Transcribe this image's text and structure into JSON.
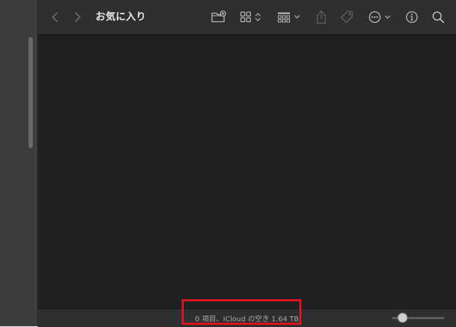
{
  "window": {
    "title": "お気に入り"
  },
  "toolbar": {
    "back": "chevron-left-icon",
    "forward": "chevron-right-icon",
    "new_folder": "folder-plus-icon",
    "view_mode": "grid-view-icon",
    "group": "group-icon",
    "share": "share-icon",
    "tag": "tag-icon",
    "more": "ellipsis-circle-icon",
    "info": "info-icon",
    "search": "search-icon"
  },
  "status": {
    "text": "0 項目、iCloud の空き 1.64 TB",
    "zoom_level": 0.2
  },
  "colors": {
    "highlight": "#e0121c",
    "window_bg": "#1f2022",
    "toolbar_bg": "#2e2f31",
    "sidebar_bg": "#3d3d3e"
  }
}
